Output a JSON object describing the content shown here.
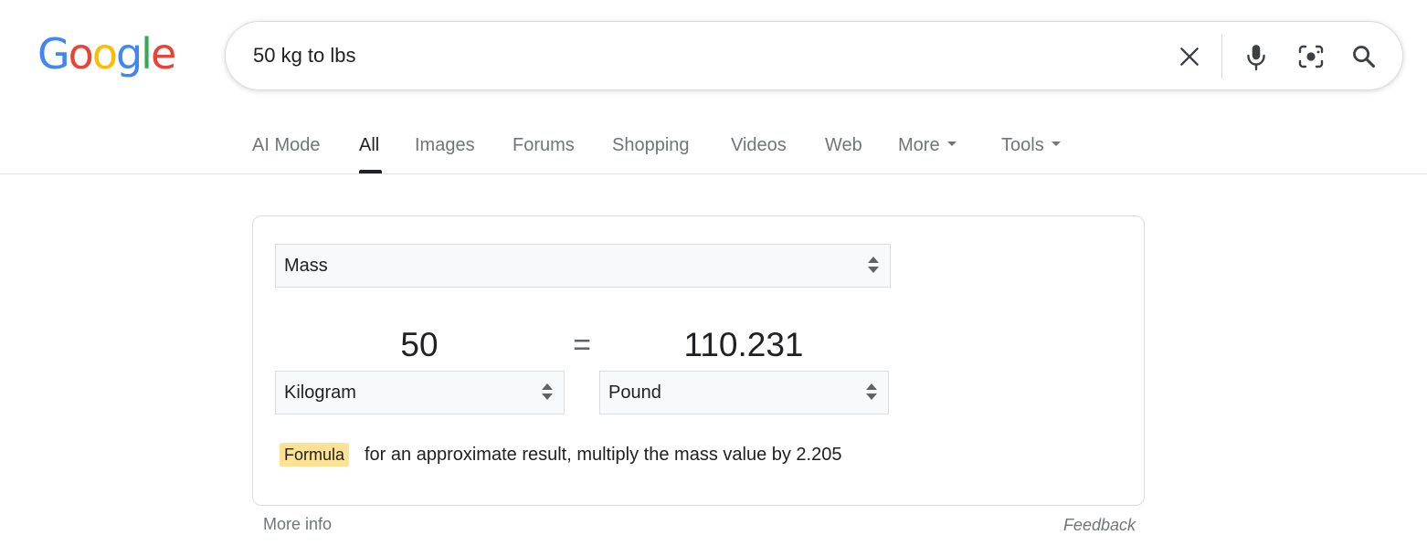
{
  "logo": {
    "letters": [
      {
        "char": "G",
        "color": "#4285f4"
      },
      {
        "char": "o",
        "color": "#ea4335"
      },
      {
        "char": "o",
        "color": "#fbbc05"
      },
      {
        "char": "g",
        "color": "#4285f4"
      },
      {
        "char": "l",
        "color": "#34a853"
      },
      {
        "char": "e",
        "color": "#ea4335"
      }
    ]
  },
  "search": {
    "query": "50 kg to lbs",
    "icons": [
      "close-icon",
      "microphone-icon",
      "lens-camera-icon",
      "search-icon"
    ],
    "accent": "#4285f4"
  },
  "tabs": [
    {
      "label": "AI Mode",
      "active": false
    },
    {
      "label": "All",
      "active": true
    },
    {
      "label": "Images",
      "active": false
    },
    {
      "label": "Forums",
      "active": false
    },
    {
      "label": "Shopping",
      "active": false
    },
    {
      "label": "Videos",
      "active": false
    },
    {
      "label": "Web",
      "active": false
    },
    {
      "label": "More",
      "active": false,
      "dropdown": true
    },
    {
      "label": "Tools",
      "active": false,
      "dropdown": true
    }
  ],
  "converter": {
    "quantity": "Mass",
    "from_value": "50",
    "from_unit": "Kilogram",
    "equals": "=",
    "to_value": "110.231",
    "to_unit": "Pound",
    "formula_label": "Formula",
    "formula_text": "for an approximate result, multiply the mass value by 2.205",
    "formula_color": "#fde293"
  },
  "footer": {
    "more_info": "More info",
    "feedback": "Feedback"
  }
}
